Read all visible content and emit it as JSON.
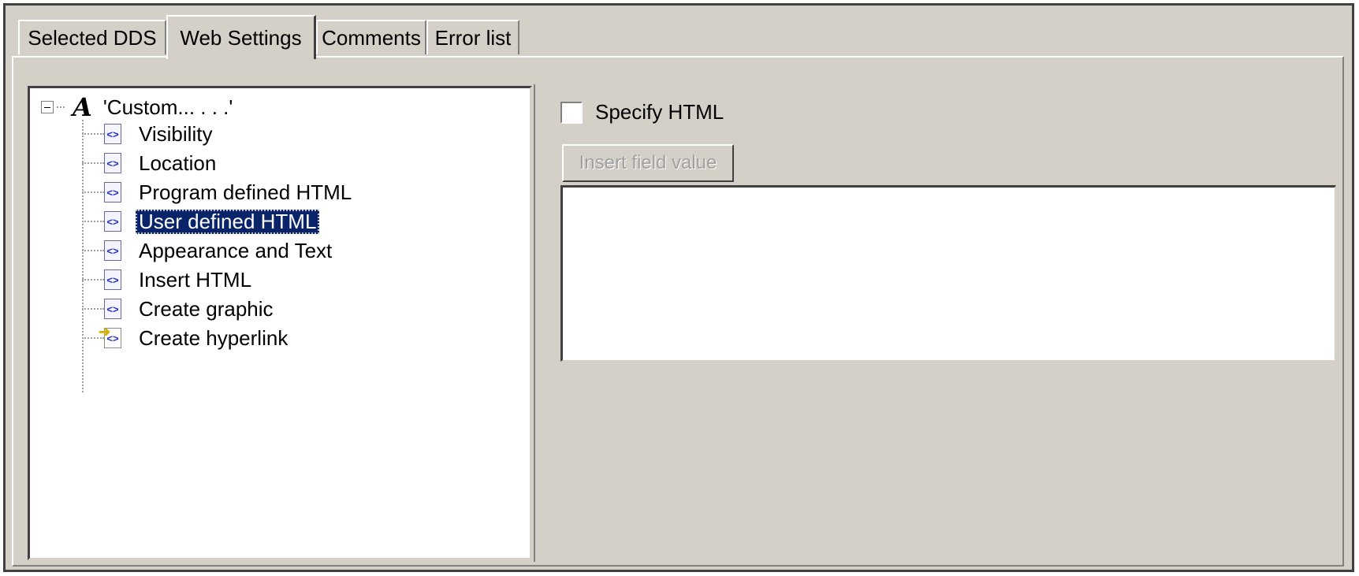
{
  "tabs": [
    {
      "label": "Selected DDS"
    },
    {
      "label": "Web Settings"
    },
    {
      "label": "Comments"
    },
    {
      "label": "Error list"
    }
  ],
  "active_tab": "Web Settings",
  "tree": {
    "root": {
      "label": "'Custom... . . .'",
      "icon": "letter-a-icon"
    },
    "items": [
      {
        "label": "Visibility",
        "icon": "html-node-icon"
      },
      {
        "label": "Location",
        "icon": "html-node-icon"
      },
      {
        "label": "Program defined HTML",
        "icon": "html-node-icon"
      },
      {
        "label": "User defined HTML",
        "icon": "html-node-icon",
        "selected": true
      },
      {
        "label": "Appearance and Text",
        "icon": "html-node-icon"
      },
      {
        "label": "Insert HTML",
        "icon": "html-node-icon"
      },
      {
        "label": "Create graphic",
        "icon": "html-node-icon"
      },
      {
        "label": "Create hyperlink",
        "icon": "hyperlink-node-icon"
      }
    ]
  },
  "right": {
    "specify_html_label": "Specify HTML",
    "specify_html_checked": false,
    "insert_button_label": "Insert field value",
    "insert_button_enabled": false,
    "html_text": ""
  }
}
